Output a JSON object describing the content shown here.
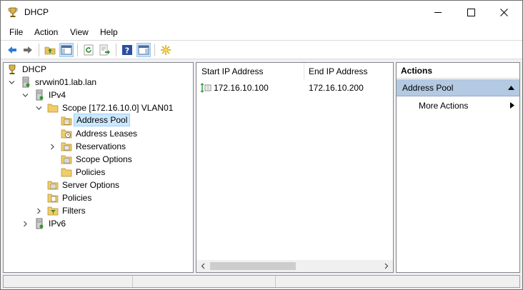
{
  "window": {
    "title": "DHCP",
    "icon": "dhcp-trophy-icon"
  },
  "menu": [
    "File",
    "Action",
    "View",
    "Help"
  ],
  "toolbar": {
    "buttons": [
      "back-arrow-icon",
      "forward-arrow-icon",
      "up-folder-icon",
      "show-hide-console-tree-icon",
      "refresh-icon",
      "export-list-icon",
      "help-icon",
      "show-hide-action-pane-icon",
      "new-item-star-icon"
    ]
  },
  "tree": {
    "root": "DHCP",
    "server": "srvwin01.lab.lan",
    "ipv4": "IPv4",
    "scope": "Scope [172.16.10.0] VLAN01",
    "address_pool": "Address Pool",
    "address_leases": "Address Leases",
    "reservations": "Reservations",
    "scope_options": "Scope Options",
    "scope_policies": "Policies",
    "server_options": "Server Options",
    "policies": "Policies",
    "filters": "Filters",
    "ipv6": "IPv6"
  },
  "list": {
    "columns": [
      "Start IP Address",
      "End IP Address"
    ],
    "rows": [
      {
        "start": "172.16.10.100",
        "end": "172.16.10.200"
      }
    ]
  },
  "actions": {
    "header": "Actions",
    "section": "Address Pool",
    "items": [
      "More Actions"
    ]
  },
  "colors": {
    "selection": "#cce8ff",
    "action_section": "#b4c9e2"
  }
}
